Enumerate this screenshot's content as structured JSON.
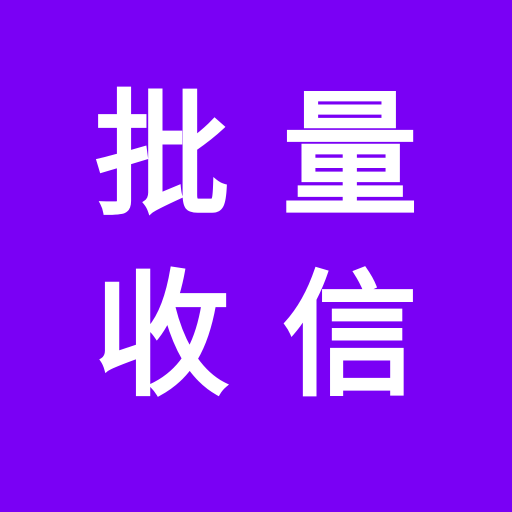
{
  "icon": {
    "background_color": "#7A00F5",
    "text_color": "#FFFFFF",
    "characters": [
      "批",
      "量",
      "收",
      "信"
    ]
  }
}
